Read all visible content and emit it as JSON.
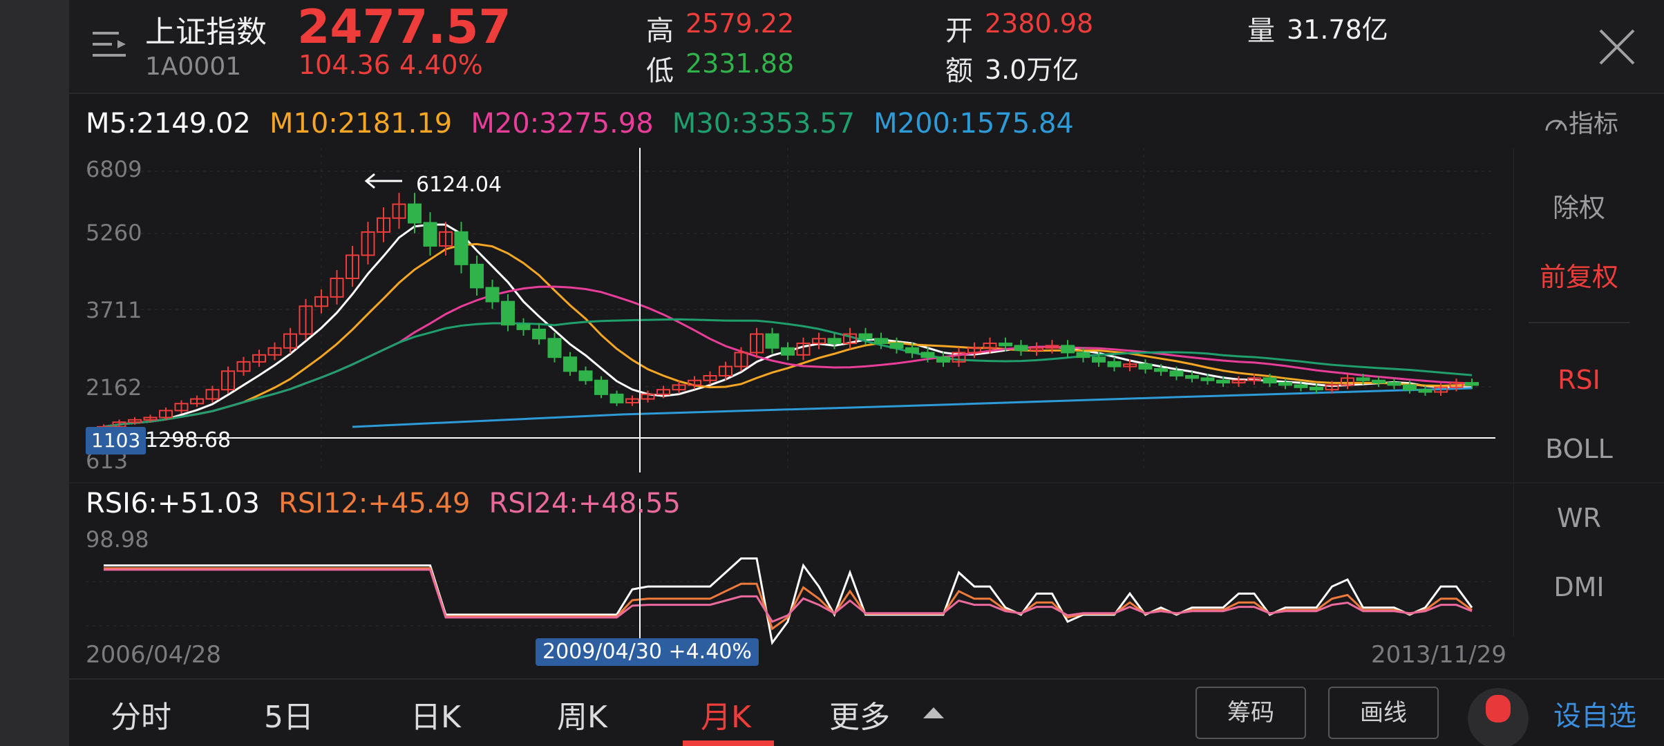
{
  "header": {
    "index_name": "上证指数",
    "index_code": "1A0001",
    "price": "2477.57",
    "change": "104.36",
    "change_pct": "4.40%",
    "high_label": "高",
    "high_value": "2579.22",
    "low_label": "低",
    "low_value": "2331.88",
    "open_label": "开",
    "open_value": "2380.98",
    "amount_label": "额",
    "amount_value": "3.0万亿",
    "volume_label": "量",
    "volume_value": "31.78亿"
  },
  "ma": {
    "m5": "M5:2149.02",
    "m10": "M10:2181.19",
    "m20": "M20:3275.98",
    "m30": "M30:3353.57",
    "m200": "M200:1575.84"
  },
  "indicator_button": "指标",
  "price_axis": [
    "6809",
    "5260",
    "3711",
    "2162",
    "613"
  ],
  "peak_label": "6124.04",
  "crosshair": {
    "price_badge": "1103",
    "price_value": "1298.68",
    "date_badge": "2009/04/30 +4.40%"
  },
  "rsi": {
    "rsi6": "RSI6:+51.03",
    "rsi12": "RSI12:+45.49",
    "rsi24": "RSI24:+48.55",
    "axis_top": "98.98"
  },
  "dates": {
    "start": "2006/04/28",
    "end": "2013/11/29"
  },
  "side_panel": [
    "除权",
    "前复权",
    "RSI",
    "BOLL",
    "WR",
    "DMI"
  ],
  "bottom_tabs": [
    "分时",
    "5日",
    "日K",
    "周K",
    "月K",
    "更多"
  ],
  "bottom_buttons": {
    "chips": "筹码",
    "draw": "画线",
    "watchlist": "设自选"
  },
  "colors": {
    "up": "#ef3d3b",
    "down": "#2fb34a",
    "m5": "#ffffff",
    "m10": "#f5a623",
    "m20": "#e83e9a",
    "m30": "#1f9e6e",
    "m200": "#2d9bd8",
    "rsi12": "#f07a3a",
    "rsi24": "#ea6a9c"
  }
}
